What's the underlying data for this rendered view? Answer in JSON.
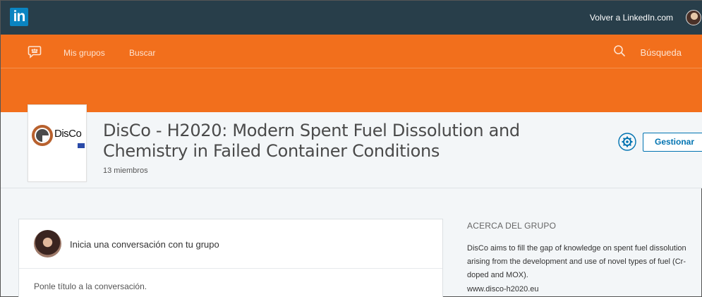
{
  "topbar": {
    "logo_text": "in",
    "back_link": "Volver a LinkedIn.com",
    "color": "#283e4a"
  },
  "subnav": {
    "color": "#f26f1c",
    "groups_link": "Mis grupos",
    "search_link": "Buscar",
    "search_placeholder": "Búsqueda"
  },
  "group": {
    "logo_text": "DisCo",
    "title": "DisCo - H2020: Modern Spent Fuel Dissolution and Chemistry in Failed Container Conditions",
    "members": "13 miembros",
    "manage_label": "Gestionar"
  },
  "composer": {
    "prompt": "Inicia una conversación con tu grupo",
    "title_placeholder": "Ponle título a la conversación."
  },
  "about": {
    "heading": "ACERCA DEL GRUPO",
    "description": "DisCo aims to fill the gap of knowledge on spent fuel dissolution arising from the development and use of novel types of fuel (Cr- doped and MOX).",
    "url": "www.disco-h2020.eu"
  },
  "icons": {
    "groups": "groups-icon",
    "search": "search-icon",
    "settings": "gear-icon"
  }
}
